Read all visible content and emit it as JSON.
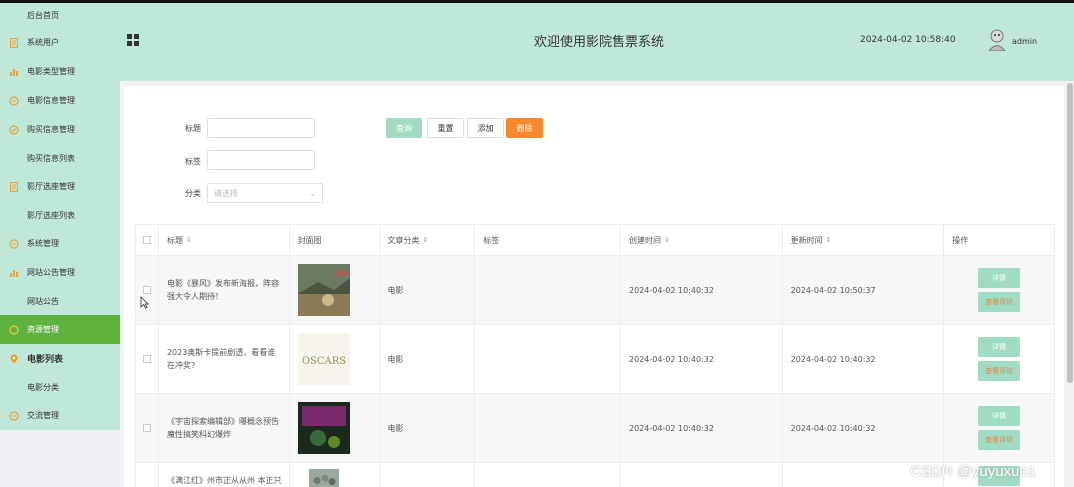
{
  "sidebar": {
    "items": [
      {
        "label": "后台首页",
        "icon": "none",
        "sub": true,
        "first": true
      },
      {
        "label": "系统用户",
        "icon": "document-icon"
      },
      {
        "label": "电影类型管理",
        "icon": "bar-chart-icon"
      },
      {
        "label": "电影信息管理",
        "icon": "chat-icon"
      },
      {
        "label": "购买信息管理",
        "icon": "check-circle-icon"
      },
      {
        "label": "购买信息列表",
        "icon": "none",
        "sub": true
      },
      {
        "label": "影厅选座管理",
        "icon": "document-icon"
      },
      {
        "label": "影厅选座列表",
        "icon": "none",
        "sub": true
      },
      {
        "label": "系统管理",
        "icon": "chat-icon"
      },
      {
        "label": "网站公告管理",
        "icon": "bar-chart-icon"
      },
      {
        "label": "网站公告",
        "icon": "none",
        "sub": true
      },
      {
        "label": "资源管理",
        "icon": "circle-icon",
        "active": true
      },
      {
        "label": "电影列表",
        "icon": "location-pin-icon",
        "bold": true
      },
      {
        "label": "电影分类",
        "icon": "none",
        "sub": true
      },
      {
        "label": "交流管理",
        "icon": "chat-icon"
      }
    ]
  },
  "header": {
    "title": "欢迎使用影院售票系统",
    "datetime": "2024-04-02 10:58:40",
    "username": "admin"
  },
  "filters": {
    "title_label": "标题",
    "tag_label": "标签",
    "category_label": "分类",
    "category_placeholder": "请选择"
  },
  "buttons": {
    "query": "查询",
    "reset": "重置",
    "add": "添加",
    "delete": "删除"
  },
  "table": {
    "headers": {
      "title": "标题",
      "cover": "封面图",
      "category": "文章分类",
      "tag": "标签",
      "created": "创建时间",
      "updated": "更新时间",
      "actions": "操作"
    },
    "rows": [
      {
        "title": "电影《暴风》发布新海报，阵容强大令人期待！",
        "category": "电影",
        "tag": "",
        "created": "2024-04-02 10:40:32",
        "updated": "2024-04-02 10:50:37",
        "cover_text": ""
      },
      {
        "title": "2023奥斯卡提前剧透，看看谁在冲奖?",
        "category": "电影",
        "tag": "",
        "created": "2024-04-02 10:40:32",
        "updated": "2024-04-02 10:40:32",
        "cover_text": "OSCARS"
      },
      {
        "title": "《宇宙探索编辑部》曝概念预告 魔性搞笑科幻爆炸",
        "category": "电影",
        "tag": "",
        "created": "2024-04-02 10:40:32",
        "updated": "2024-04-02 10:40:32",
        "cover_text": ""
      }
    ],
    "partial_row_title": "《满江红》州市正从从州 本正只着到",
    "action_detail": "详情",
    "action_review": "查看评论"
  },
  "watermark": "CSDN @yuyuxun1",
  "colors": {
    "mint": "#bfe8d8",
    "active_green": "#5db33d",
    "query_button": "#a0dcc4",
    "delete_button": "#f7882d"
  }
}
